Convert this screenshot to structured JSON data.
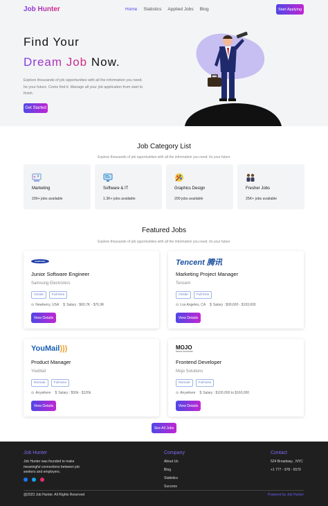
{
  "nav": {
    "logo": "Job Hunter",
    "links": [
      "Home",
      "Statistics",
      "Applied Jobs",
      "Blog"
    ],
    "cta": "Start Applying"
  },
  "hero": {
    "line1": "Find Your",
    "line2_highlight": "Dream Job",
    "line2_rest": " Now.",
    "description": "Explore thousands of job opportunities with all the information you need. Its your future. Come find it. Manage all your job application from start to finish.",
    "button": "Get Started"
  },
  "categories": {
    "title": "Job Category List",
    "subtitle": "Explore thousands of job opportunities with all the information you need. Its your future",
    "items": [
      {
        "name": "Marketing",
        "count": "200+ jobs available",
        "icon": "marketing-icon"
      },
      {
        "name": "Software & IT",
        "count": "1.3K+ jobs available",
        "icon": "software-icon"
      },
      {
        "name": "Graphics Design",
        "count": "200 jobs available",
        "icon": "design-icon"
      },
      {
        "name": "Fresher Jobs",
        "count": "25K+ jobs available",
        "icon": "fresher-icon"
      }
    ]
  },
  "featured": {
    "title": "Featured Jobs",
    "subtitle": "Explore thousands of job opportunities with all the information you need. Its your future",
    "jobs": [
      {
        "logo": "SAMSUNG",
        "title": "Junior Software Engineer",
        "company": "Samsung Electronics",
        "tag1": "Onsite",
        "tag2": "Full-time",
        "location": "Newberry, USA",
        "salary": "Salary : $60,7K - $76,9K",
        "button": "View Details"
      },
      {
        "logo": "Tencent 腾讯",
        "title": "Marketing Project Manager",
        "company": "Tencent",
        "tag1": "Onsite",
        "tag2": "Full-time",
        "location": "Los Angeles, CA",
        "salary": "Salary : $99,600 - $193,600",
        "button": "View Details"
      },
      {
        "logo": "YouMail",
        "title": "Product Manager",
        "company": "YouMail",
        "tag1": "Remote",
        "tag2": "Full-time",
        "location": "Anywhere",
        "salary": "Salary : $50k - $120k",
        "button": "View Details"
      },
      {
        "logo": "MOJO",
        "logo_sub": "DIGITAL SOLUTIONS",
        "title": "Frontend Developer",
        "company": "Mojo Solutions",
        "tag1": "Remote",
        "tag2": "Full-time",
        "location": "Anywhere",
        "salary": "Salary : $100,000 to $160,000",
        "button": "View Details"
      }
    ],
    "all_button": "See All Jobs"
  },
  "footer": {
    "brand": "Job Hunter",
    "about": "Job Hunter was founded to make meaningful connections between job seekers and employers.",
    "company_head": "Company",
    "company_links": [
      "About Us",
      "Blog",
      "Statistics",
      "Success"
    ],
    "contact_head": "Contact",
    "address": "524 Broadway , NYC",
    "phone": "+1 777 - 978 - 5570",
    "copyright": "@2023 Job Hunter. All Rights Reserved",
    "powered": "Powered by Job Hunter"
  },
  "colors": {
    "accent_start": "#4f46e5",
    "accent_end": "#c026d3",
    "footer_bg": "#1f1f1f"
  }
}
